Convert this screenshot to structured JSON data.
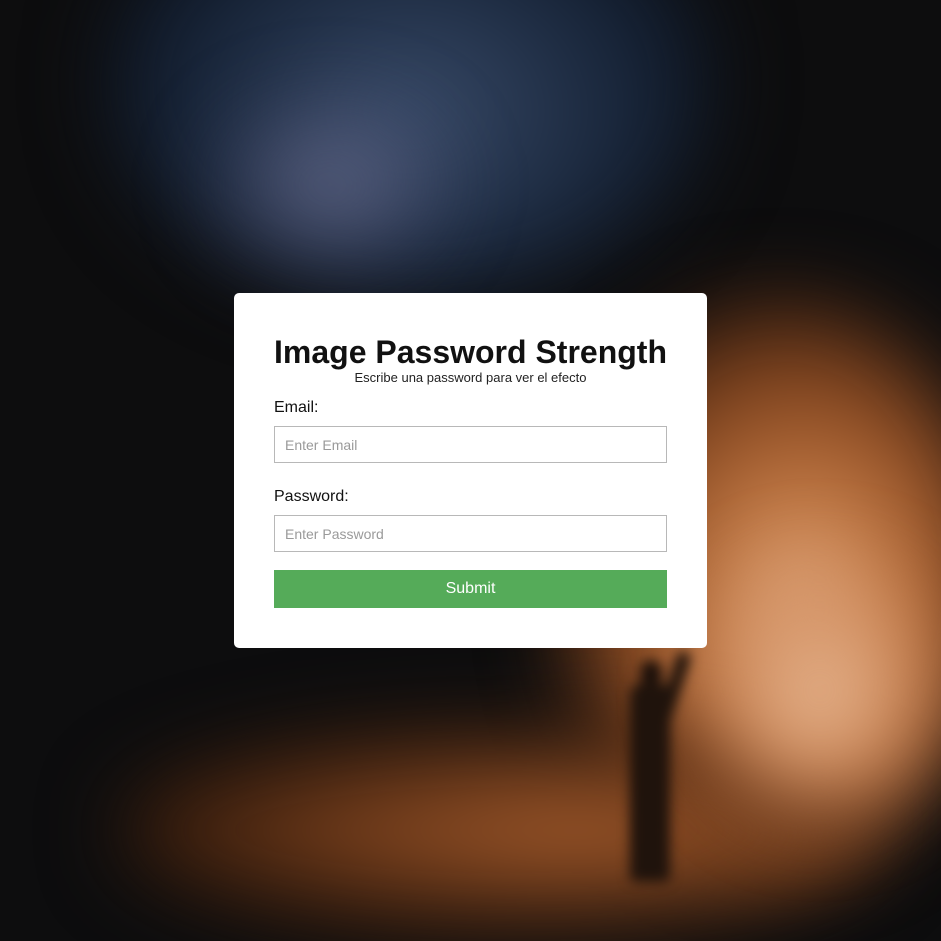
{
  "card": {
    "title": "Image Password Strength",
    "subtitle": "Escribe una password para ver el efecto"
  },
  "form": {
    "email": {
      "label": "Email:",
      "placeholder": "Enter Email",
      "value": ""
    },
    "password": {
      "label": "Password:",
      "placeholder": "Enter Password",
      "value": ""
    },
    "submit_label": "Submit"
  },
  "colors": {
    "submit_button": "#55ab59",
    "card_background": "#ffffff",
    "page_background": "#0d0d0e"
  }
}
